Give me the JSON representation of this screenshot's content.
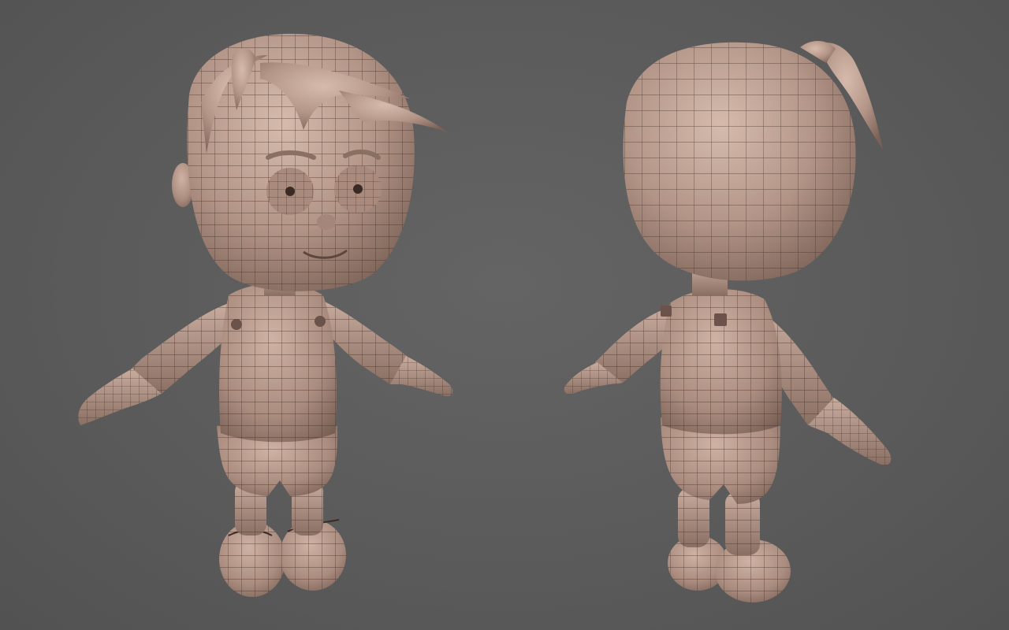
{
  "scene": {
    "background_color": "#5a5a5a",
    "clay_color": "#b39587",
    "clay_shadow": "#7f655a",
    "clay_highlight": "#d3b7a9",
    "wire_color": "#3a2a24",
    "views": [
      {
        "name": "front-view"
      },
      {
        "name": "back-view"
      }
    ]
  }
}
